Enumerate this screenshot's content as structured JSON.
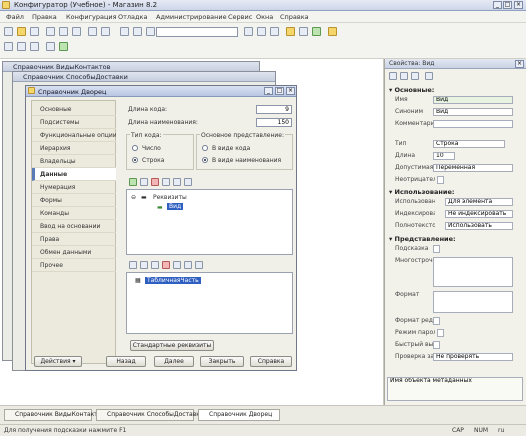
{
  "app": {
    "title": "Конфигуратор (Учебное) - Магазин 8.2"
  },
  "menu": [
    "Файл",
    "Правка",
    "Конфигурация",
    "Отладка",
    "Администрирование",
    "Сервис",
    "Окна",
    "Справка"
  ],
  "background_windows": [
    {
      "title": "Справочник ВидыКонтактов"
    },
    {
      "title": "Справочник СпособыДоставки"
    }
  ],
  "dialog": {
    "title": "Справочник Дворец",
    "left_items": [
      "Основные",
      "Подсистемы",
      "Функциональные опции",
      "Иерархия",
      "Владельцы",
      "Данные",
      "Нумерация",
      "Формы",
      "Команды",
      "Ввод на основании",
      "Права",
      "Обмен данными",
      "Прочее"
    ],
    "selected_left_index": 5,
    "code_length_label": "Длина кода:",
    "code_length_value": "9",
    "name_length_label": "Длина наименования:",
    "name_length_value": "150",
    "code_type_label": "Тип кода:",
    "code_type_options": [
      "Число",
      "Строка"
    ],
    "code_type_selected": 1,
    "main_repr_label": "Основное представление:",
    "main_repr_options": [
      "В виде кода",
      "В виде наименования"
    ],
    "main_repr_selected": 1,
    "attributes_root": "Реквизиты",
    "attribute_item": "Вид",
    "tabular_item": "ТабличнаяЧасть",
    "standard_attrs_button": "Стандартные реквизиты",
    "footer_buttons": [
      "Действия",
      "Назад",
      "Далее",
      "Закрыть",
      "Справка"
    ]
  },
  "properties": {
    "title": "Свойства: Вид",
    "section_main": "Основные:",
    "name_label": "Имя",
    "name_value": "Вид",
    "synonym_label": "Синоним",
    "synonym_value": "Вид",
    "comment_label": "Комментарий",
    "type_label": "Тип",
    "type_value": "Строка",
    "length_label": "Длина",
    "length_value": "10",
    "allowed_length_label": "Допустимая длина",
    "allowed_length_value": "Переменная",
    "nonneg_label": "Неотрицательное",
    "section_usage": "Использование:",
    "usage_label": "Использование",
    "usage_value": "Для элемента",
    "index_label": "Индексирование",
    "index_value": "Не индексировать",
    "fulltext_label": "Полнотекстовый поиск",
    "fulltext_value": "Использовать",
    "section_repr": "Представление:",
    "prompt_label": "Подсказка",
    "multiline_label": "Многострочный режим",
    "format_label": "Формат",
    "edit_format_label": "Формат редактирования",
    "password_label": "Режим пароля",
    "choice_label": "Быстрый выбор",
    "choice_check_label": "Проверка заполнения",
    "choice_check_value": "Не проверять",
    "footer_text": "Имя объекта метаданных"
  },
  "taskbar": [
    "Справочник ВидыКонтактов",
    "Справочник СпособыДоставки",
    "Справочник Дворец"
  ],
  "status": {
    "text": "Для получения подсказки нажмите F1",
    "cap": "CAP",
    "num": "NUM",
    "lang": "ru"
  }
}
